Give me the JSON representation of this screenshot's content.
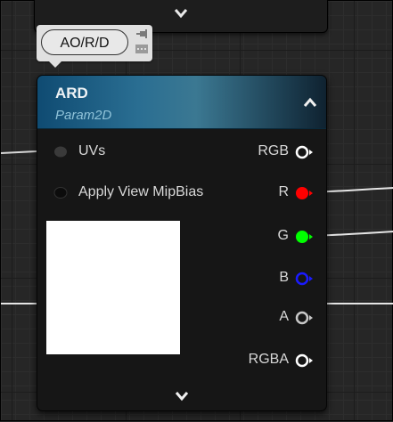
{
  "comment": {
    "label": "AO/R/D"
  },
  "node": {
    "title": "ARD",
    "subtitle": "Param2D",
    "inputs": [
      {
        "label": "UVs"
      },
      {
        "label": "Apply View MipBias"
      }
    ],
    "outputs": [
      {
        "label": "RGB",
        "color": "#ffffff"
      },
      {
        "label": "R",
        "color": "#ff0000"
      },
      {
        "label": "G",
        "color": "#00ff00"
      },
      {
        "label": "B",
        "color": "#0000ff"
      },
      {
        "label": "A",
        "color": "#c8c8c8"
      },
      {
        "label": "RGBA",
        "color": "#ffffff"
      }
    ]
  },
  "icons": [
    "chevron-down-icon",
    "pin-icon",
    "chevron-up-icon"
  ]
}
